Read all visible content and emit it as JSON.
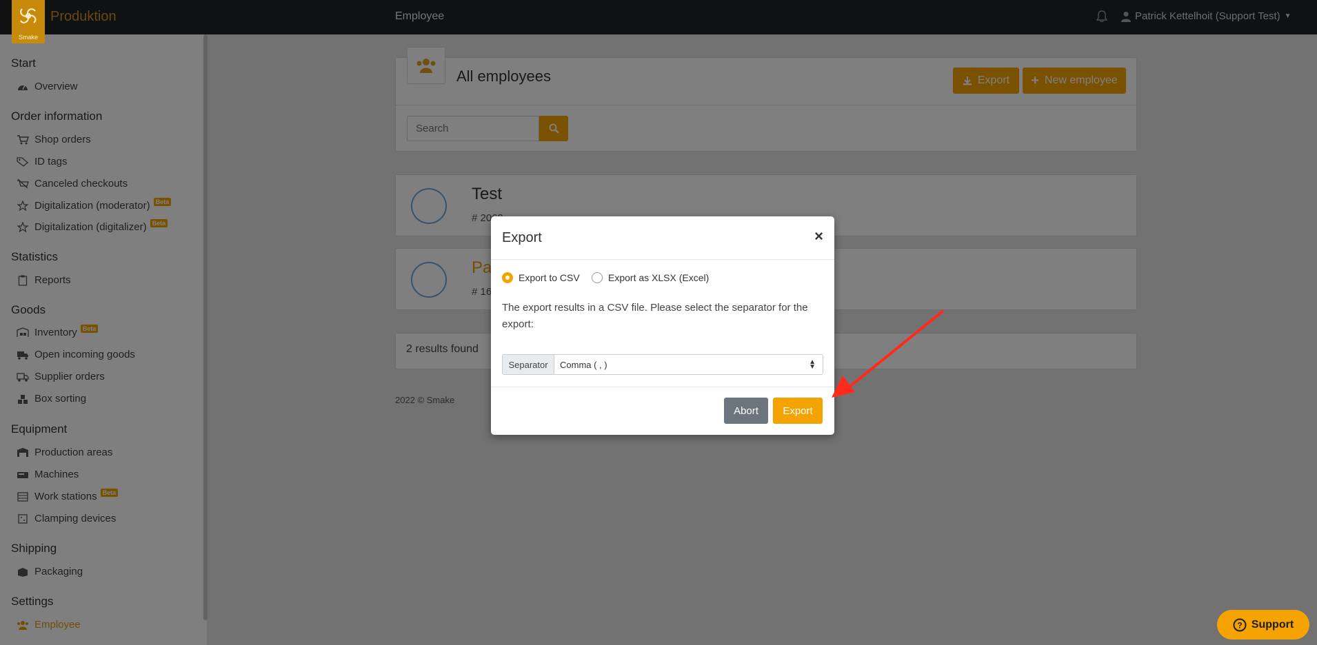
{
  "topbar": {
    "logo_text": "Smake",
    "app_title": "Produktion",
    "page_title": "Employee",
    "user_name": "Patrick Kettelhoit (Support Test)",
    "bell_icon": "bell-icon",
    "user_icon": "user-icon"
  },
  "sidebar": {
    "sections": [
      {
        "title": "Start",
        "items": [
          {
            "label": "Overview",
            "icon": "dashboard-icon"
          }
        ]
      },
      {
        "title": "Order information",
        "items": [
          {
            "label": "Shop orders",
            "icon": "shop-icon"
          },
          {
            "label": "ID tags",
            "icon": "tags-icon"
          },
          {
            "label": "Canceled checkouts",
            "icon": "canceled-icon"
          },
          {
            "label": "Digitalization (moderator)",
            "icon": "star-icon",
            "badge": "Beta"
          },
          {
            "label": "Digitalization (digitalizer)",
            "icon": "star-icon",
            "badge": "Beta"
          }
        ]
      },
      {
        "title": "Statistics",
        "items": [
          {
            "label": "Reports",
            "icon": "clipboard-icon"
          }
        ]
      },
      {
        "title": "Goods",
        "items": [
          {
            "label": "Inventory",
            "icon": "warehouse-icon",
            "badge": "Beta"
          },
          {
            "label": "Open incoming goods",
            "icon": "truck-icon"
          },
          {
            "label": "Supplier orders",
            "icon": "truck-icon"
          },
          {
            "label": "Box sorting",
            "icon": "boxes-icon"
          }
        ]
      },
      {
        "title": "Equipment",
        "items": [
          {
            "label": "Production areas",
            "icon": "warehouse-icon"
          },
          {
            "label": "Machines",
            "icon": "machine-icon"
          },
          {
            "label": "Work stations",
            "icon": "workstation-icon",
            "badge": "Beta"
          },
          {
            "label": "Clamping devices",
            "icon": "clamp-icon"
          }
        ]
      },
      {
        "title": "Shipping",
        "items": [
          {
            "label": "Packaging",
            "icon": "package-icon"
          }
        ]
      },
      {
        "title": "Settings",
        "items": [
          {
            "label": "Employee",
            "icon": "users-icon",
            "active": true
          }
        ]
      }
    ]
  },
  "main": {
    "card_title": "All employees",
    "export_label": "Export",
    "new_employee_label": "New employee",
    "search_placeholder": "Search",
    "employees": [
      {
        "name": "Test",
        "meta": "# 2069"
      },
      {
        "name": "Pa",
        "meta": "# 16"
      }
    ],
    "results_text": "2 results found",
    "footer_text": "2022 © Smake"
  },
  "modal": {
    "title": "Export",
    "close": "×",
    "option_csv": "Export to CSV",
    "option_xlsx": "Export as XLSX (Excel)",
    "selected_option": "csv",
    "description": "The export results in a CSV file. Please select the separator for the export:",
    "separator_label": "Separator",
    "separator_value": "Comma ( , )",
    "abort_label": "Abort",
    "export_label": "Export"
  },
  "support_label": "Support",
  "colors": {
    "accent": "#f5a300",
    "topbar": "#1f2226",
    "annotation_arrow": "#ff2a1a"
  }
}
